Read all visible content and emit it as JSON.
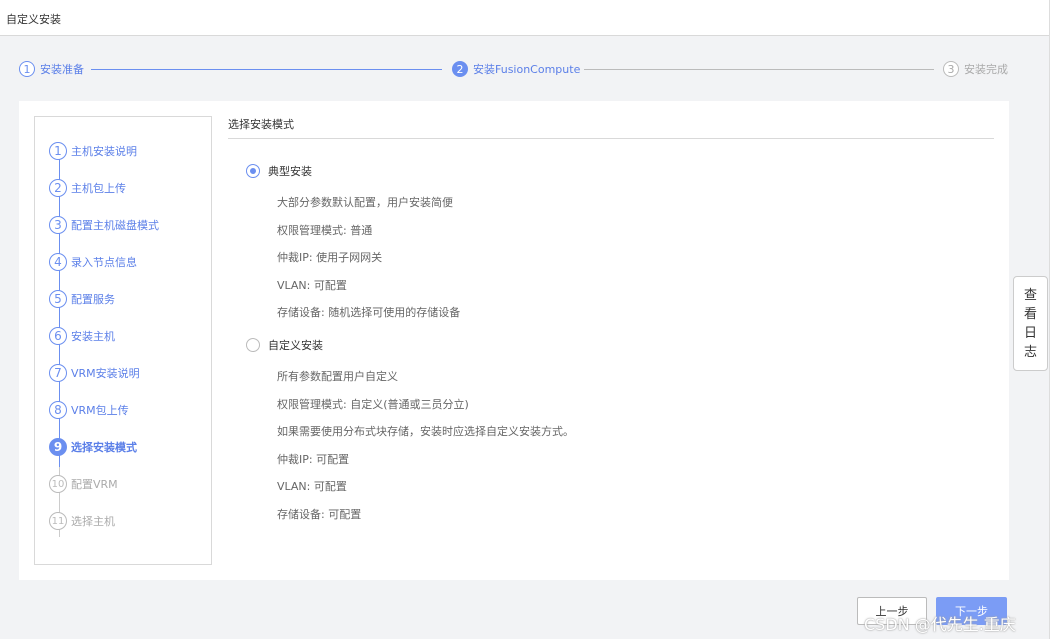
{
  "window": {
    "title": "自定义安装"
  },
  "stepper": [
    {
      "num": "1",
      "label": "安装准备"
    },
    {
      "num": "2",
      "label": "安装FusionCompute"
    },
    {
      "num": "3",
      "label": "安装完成"
    }
  ],
  "nav": [
    {
      "num": "1",
      "label": "主机安装说明"
    },
    {
      "num": "2",
      "label": "主机包上传"
    },
    {
      "num": "3",
      "label": "配置主机磁盘模式"
    },
    {
      "num": "4",
      "label": "录入节点信息"
    },
    {
      "num": "5",
      "label": "配置服务"
    },
    {
      "num": "6",
      "label": "安装主机"
    },
    {
      "num": "7",
      "label": "VRM安装说明"
    },
    {
      "num": "8",
      "label": "VRM包上传"
    },
    {
      "num": "9",
      "label": "选择安装模式"
    },
    {
      "num": "10",
      "label": "配置VRM"
    },
    {
      "num": "11",
      "label": "选择主机"
    }
  ],
  "section": {
    "title": "选择安装模式"
  },
  "options": [
    {
      "label": "典型安装",
      "selected": true,
      "lines": [
        "大部分参数默认配置，用户安装简便",
        "权限管理模式: 普通",
        "仲裁IP: 使用子网网关",
        "VLAN: 可配置",
        "存储设备: 随机选择可使用的存储设备"
      ]
    },
    {
      "label": "自定义安装",
      "selected": false,
      "lines": [
        "所有参数配置用户自定义",
        "权限管理模式: 自定义(普通或三员分立)",
        "如果需要使用分布式块存储，安装时应选择自定义安装方式。",
        "仲裁IP: 可配置",
        "VLAN: 可配置",
        "存储设备: 可配置"
      ]
    }
  ],
  "log_button": {
    "c1": "查",
    "c2": "看",
    "c3": "日",
    "c4": "志"
  },
  "buttons": {
    "prev": "上一步",
    "next": "下一步"
  },
  "watermark": "CSDN @代先生.重庆",
  "colors": {
    "accent": "#6b8ff0",
    "button_primary": "#7b9cf5"
  }
}
